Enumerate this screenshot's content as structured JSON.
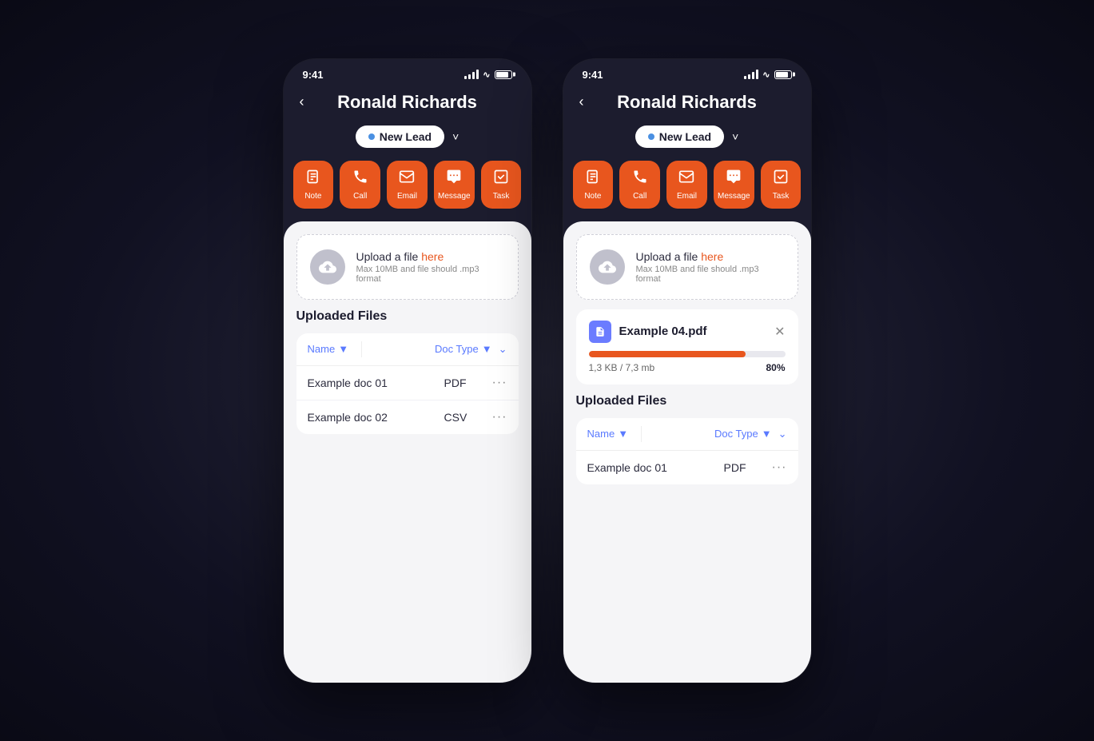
{
  "phones": [
    {
      "id": "phone-left",
      "statusBar": {
        "time": "9:41",
        "battery": 85
      },
      "header": {
        "title": "Ronald Richards",
        "backLabel": "‹"
      },
      "statusBadge": {
        "label": "New Lead",
        "dotColor": "#4a90e2"
      },
      "actions": [
        {
          "id": "note",
          "label": "Note",
          "icon": "📝"
        },
        {
          "id": "call",
          "label": "Call",
          "icon": "📞"
        },
        {
          "id": "email",
          "label": "Email",
          "icon": "✉"
        },
        {
          "id": "message",
          "label": "Message",
          "icon": "💬"
        },
        {
          "id": "task",
          "label": "Task",
          "icon": "☑"
        }
      ],
      "uploadArea": {
        "mainText": "Upload a file ",
        "hereText": "here",
        "subText": "Max 10MB and file should .mp3 format"
      },
      "uploadedFiles": {
        "sectionTitle": "Uploaded Files",
        "columns": [
          {
            "label": "Name",
            "hasCaret": true
          },
          {
            "label": "Doc Type",
            "hasCaret": true
          }
        ],
        "rows": [
          {
            "name": "Example doc 01",
            "type": "PDF"
          },
          {
            "name": "Example doc 02",
            "type": "CSV"
          }
        ]
      },
      "hasProgress": false
    },
    {
      "id": "phone-right",
      "statusBar": {
        "time": "9:41",
        "battery": 85
      },
      "header": {
        "title": "Ronald Richards",
        "backLabel": "‹"
      },
      "statusBadge": {
        "label": "New Lead",
        "dotColor": "#4a90e2"
      },
      "actions": [
        {
          "id": "note",
          "label": "Note",
          "icon": "📝"
        },
        {
          "id": "call",
          "label": "Call",
          "icon": "📞"
        },
        {
          "id": "email",
          "label": "Email",
          "icon": "✉"
        },
        {
          "id": "message",
          "label": "Message",
          "icon": "💬"
        },
        {
          "id": "task",
          "label": "Task",
          "icon": "☑"
        }
      ],
      "uploadArea": {
        "mainText": "Upload a file ",
        "hereText": "here",
        "subText": "Max 10MB and file should .mp3 format"
      },
      "uploadProgress": {
        "fileName": "Example 04.pdf",
        "sizeText": "1,3 KB / 7,3 mb",
        "percent": 80,
        "percentLabel": "80%",
        "barWidth": "80%"
      },
      "uploadedFiles": {
        "sectionTitle": "Uploaded Files",
        "columns": [
          {
            "label": "Name",
            "hasCaret": true
          },
          {
            "label": "Doc Type",
            "hasCaret": true
          }
        ],
        "rows": [
          {
            "name": "Example doc 01",
            "type": "PDF"
          }
        ]
      },
      "hasProgress": true
    }
  ],
  "accent": "#e8561e",
  "badgeBg": "#ffffff",
  "badgeTextColor": "#1c1c2e"
}
